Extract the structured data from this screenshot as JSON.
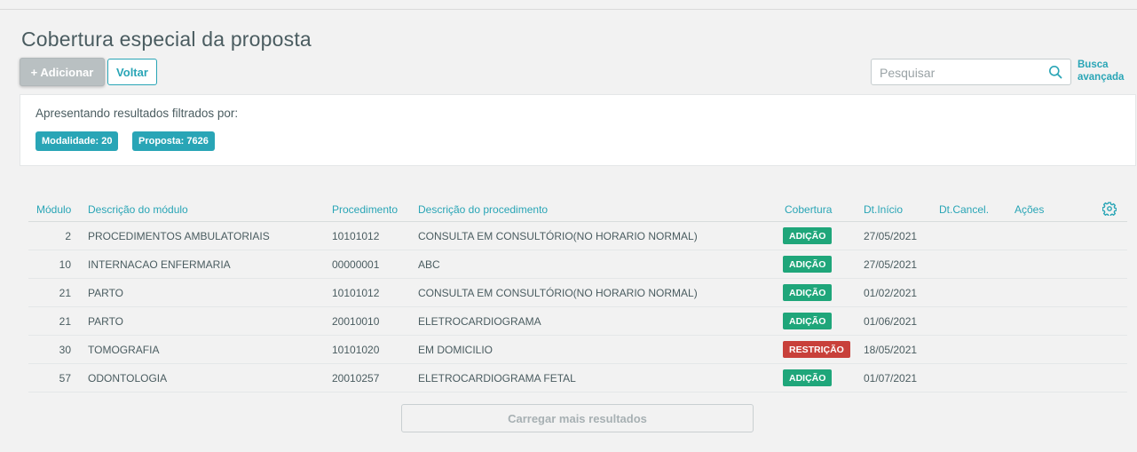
{
  "page": {
    "title": "Cobertura especial da proposta"
  },
  "toolbar": {
    "add_label": "+ Adicionar",
    "back_label": "Voltar"
  },
  "search": {
    "placeholder": "Pesquisar",
    "value": "",
    "icon": "search-icon",
    "advanced_label_line1": "Busca",
    "advanced_label_line2": "avançada"
  },
  "filters": {
    "title": "Apresentando resultados filtrados por:",
    "chips": [
      "Modalidade: 20",
      "Proposta: 7626"
    ]
  },
  "table": {
    "columns": [
      "Módulo",
      "Descrição do módulo",
      "Procedimento",
      "Descrição do procedimento",
      "Cobertura",
      "Dt.Início",
      "Dt.Cancel.",
      "Ações"
    ],
    "settings_icon": "gear-icon",
    "rows": [
      {
        "modulo": "2",
        "descricao_modulo": "PROCEDIMENTOS AMBULATORIAIS",
        "procedimento": "10101012",
        "descricao_procedimento": "CONSULTA EM CONSULTÓRIO(NO HORARIO NORMAL)",
        "cobertura": "ADIÇÃO",
        "dt_inicio": "27/05/2021",
        "dt_cancel": ""
      },
      {
        "modulo": "10",
        "descricao_modulo": "INTERNACAO ENFERMARIA",
        "procedimento": "00000001",
        "descricao_procedimento": "ABC",
        "cobertura": "ADIÇÃO",
        "dt_inicio": "27/05/2021",
        "dt_cancel": ""
      },
      {
        "modulo": "21",
        "descricao_modulo": "PARTO",
        "procedimento": "10101012",
        "descricao_procedimento": "CONSULTA EM CONSULTÓRIO(NO HORARIO NORMAL)",
        "cobertura": "ADIÇÃO",
        "dt_inicio": "01/02/2021",
        "dt_cancel": ""
      },
      {
        "modulo": "21",
        "descricao_modulo": "PARTO",
        "procedimento": "20010010",
        "descricao_procedimento": "ELETROCARDIOGRAMA",
        "cobertura": "ADIÇÃO",
        "dt_inicio": "01/06/2021",
        "dt_cancel": ""
      },
      {
        "modulo": "30",
        "descricao_modulo": "TOMOGRAFIA",
        "procedimento": "10101020",
        "descricao_procedimento": "EM DOMICILIO",
        "cobertura": "RESTRIÇÃO",
        "dt_inicio": "18/05/2021",
        "dt_cancel": ""
      },
      {
        "modulo": "57",
        "descricao_modulo": "ODONTOLOGIA",
        "procedimento": "20010257",
        "descricao_procedimento": "ELETROCARDIOGRAMA FETAL",
        "cobertura": "ADIÇÃO",
        "dt_inicio": "01/07/2021",
        "dt_cancel": ""
      }
    ]
  },
  "load_more_label": "Carregar mais resultados",
  "colors": {
    "accent": "#29a5b6",
    "addition": "#1fa67a",
    "restriction": "#c8403a"
  }
}
